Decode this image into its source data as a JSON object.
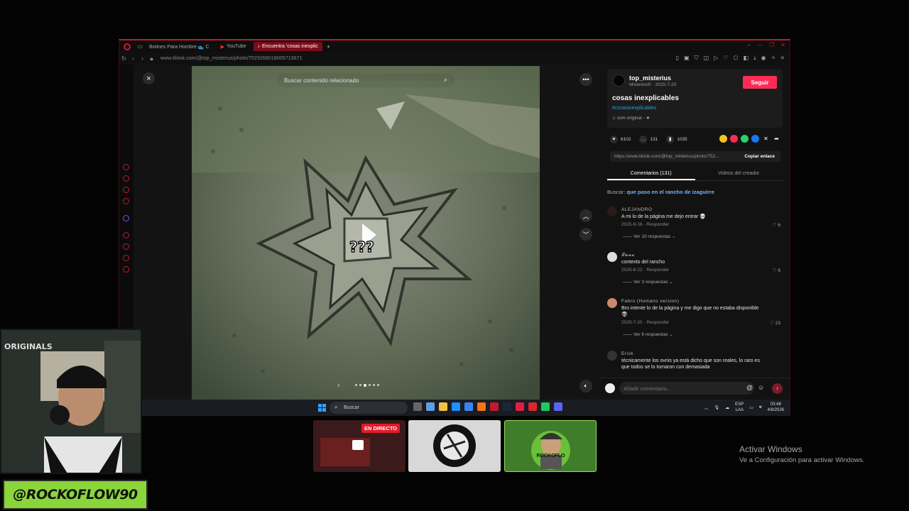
{
  "browser": {
    "tabs": [
      {
        "label": "Botines Para Hombre 👟 C"
      },
      {
        "label": "YouTube"
      },
      {
        "label": "Encuentra 'cosas inexplic"
      }
    ],
    "url": "www.tiktok.com/@top_misterius/photo/7529268018005713671"
  },
  "viewer": {
    "search_placeholder": "Buscar contenido relacionado",
    "close_icon": "×",
    "more_icon": "•••"
  },
  "post": {
    "username": "top_misterius",
    "subtitle": "Misterios® · 2025-7-20",
    "follow_label": "Seguir",
    "title": "cosas inexplicables",
    "hashtag": "#cosasinexplicables",
    "sound": "♫  som original - ★",
    "likes": "6102",
    "comments": "131",
    "saves": "1035",
    "link_url": "https://www.tiktok.com/@top_misterius/photo/752...",
    "copy_label": "Copiar enlace",
    "tab_comments": "Comentarios (131)",
    "tab_videos": "Videos del creador",
    "buscar_label": "Buscar: ",
    "buscar_query": "que paso en el rancho de izaguirre",
    "input_placeholder": "Añadir comentario..."
  },
  "comments": [
    {
      "name": "ALEJANDRO",
      "text": "A mi lo de la página me dejo entrar 💀",
      "date": "2025-9-16",
      "reply": "Responder",
      "likes": "6",
      "replies": "Ver 10 respuestas"
    },
    {
      "name": "𝓛𝓾𝓷𝓪",
      "text": "contexto del rancho",
      "date": "2025-8-22",
      "reply": "Responder",
      "likes": "6",
      "replies": "Ver 3 respuestas"
    },
    {
      "name": "Fabro (Humano version)",
      "text": "Bro intente lo de la página y me digo que no estaba disponible 👽",
      "date": "2025-7-20",
      "reply": "Responder",
      "likes": "23",
      "replies": "Ver 6 respuestas"
    },
    {
      "name": "Erick",
      "text": "técnicamente los ovnis ya está dicho que son reales, lo raro es que todos se lo tomaron con demasiada",
      "date": "",
      "reply": "",
      "likes": "",
      "replies": ""
    }
  ],
  "taskbar": {
    "search": "Buscar",
    "lang1": "ESP",
    "lang2": "LAA",
    "time": "03:48",
    "date": "4/8/2026"
  },
  "stream": {
    "originals": "ORIGINALS",
    "handle": "@ROCKOFLOW90",
    "live": "EN DIRECTO",
    "rocko": "ROCKOFLO"
  },
  "activate": {
    "line1": "Activar Windows",
    "line2": "Ve a Configuración para activar Windows."
  },
  "colors": {
    "accent": "#c4192e",
    "follow": "#fe2c55",
    "hashtag": "#2a9fd8",
    "handle_bg": "#8ad53a"
  }
}
